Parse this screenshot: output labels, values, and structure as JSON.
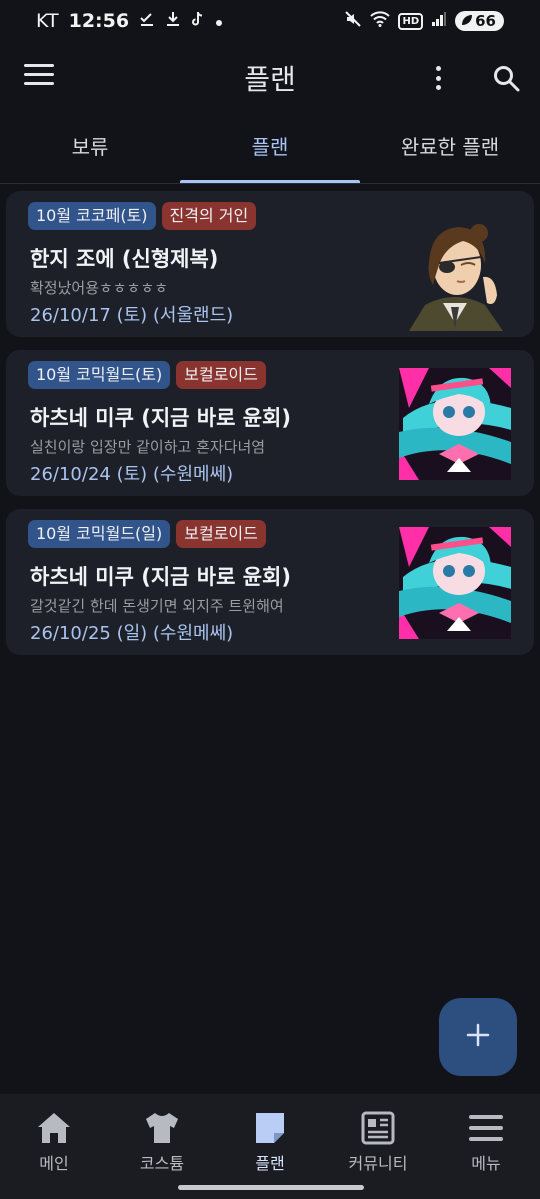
{
  "status_bar": {
    "carrier": "KT",
    "time": "12:56",
    "hd": "HD",
    "battery": "66",
    "icons": [
      "check-download-icon",
      "download-icon",
      "tiktok-icon",
      "dot-icon",
      "mute-icon",
      "wifi-icon",
      "signal-icon",
      "battery-icon"
    ]
  },
  "app_bar": {
    "title": "플랜"
  },
  "tabs": [
    {
      "label": "보류"
    },
    {
      "label": "플랜",
      "active": true
    },
    {
      "label": "완료한 플랜"
    }
  ],
  "plans": [
    {
      "event_tag": "10월 코코페(토)",
      "genre_tag": "진격의 거인",
      "title": "한지 조에 (신형제복)",
      "memo": "확정났어용ㅎㅎㅎㅎㅎ",
      "date": "26/10/17 (토) (서울랜드)",
      "thumbnail_icon": "hange-character-thumbnail"
    },
    {
      "event_tag": "10월 코믹월드(토)",
      "genre_tag": "보컬로이드",
      "title": "하츠네 미쿠 (지금 바로 윤회)",
      "memo": "실친이랑 입장만 같이하고 혼자다녀염",
      "date": "26/10/24 (토) (수원메쎄)",
      "thumbnail_icon": "miku-character-thumbnail"
    },
    {
      "event_tag": "10월 코믹월드(일)",
      "genre_tag": "보컬로이드",
      "title": "하츠네 미쿠 (지금 바로 윤회)",
      "memo": "갈것같긴 한데 돈생기면 외지주 트윈해여",
      "date": "26/10/25 (일) (수원메쎄)",
      "thumbnail_icon": "miku-character-thumbnail"
    }
  ],
  "fab": {
    "icon": "plus-icon"
  },
  "bottom_nav": [
    {
      "label": "메인",
      "icon": "home-icon"
    },
    {
      "label": "코스튬",
      "icon": "shirt-icon"
    },
    {
      "label": "플랜",
      "icon": "note-icon",
      "active": true
    },
    {
      "label": "커뮤니티",
      "icon": "newspaper-icon"
    },
    {
      "label": "메뉴",
      "icon": "menu-icon"
    }
  ],
  "colors": {
    "background": "#121318",
    "card": "#1d2028",
    "accent": "#a7c4f5",
    "event_tag": "#31548a",
    "genre_tag": "#8a3430",
    "fab": "#2c4f80"
  }
}
